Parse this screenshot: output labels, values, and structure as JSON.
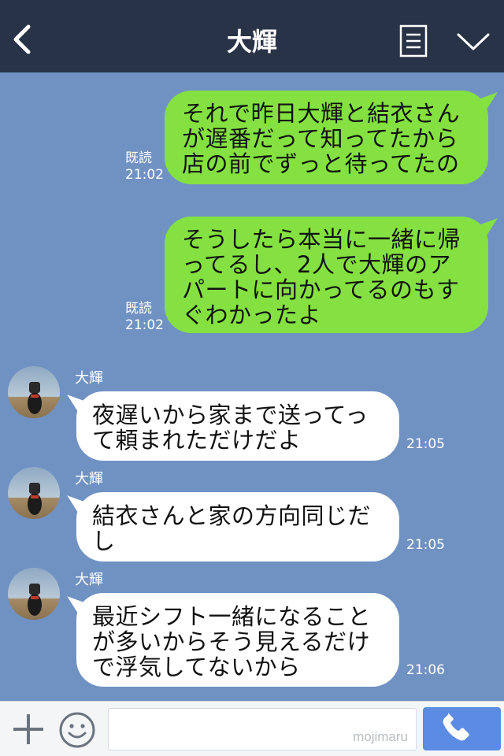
{
  "header": {
    "title": "大輝",
    "back_icon": "chevron-left-icon",
    "menu_icon": "notes-icon",
    "dropdown_icon": "chevron-down-icon",
    "background": "#293347"
  },
  "messages_out": [
    {
      "text": "それで昨日大輝と結衣さん\nが遅番だって知ってたから\n店の前でずっと待ってたの",
      "read": "既読",
      "time": "21:02"
    },
    {
      "text": "そうしたら本当に一緒に帰\nってるし、2人で大輝のア\nパートに向かってるのもす\nぐわかったよ",
      "read": "既読",
      "time": "21:02"
    }
  ],
  "messages_in": [
    {
      "sender": "大輝",
      "text": "夜遅いから家まで送ってっ\nて頼まれただけだよ",
      "time": "21:05"
    },
    {
      "sender": "大輝",
      "text": "結衣さんと家の方向同じだ\nし",
      "time": "21:05"
    },
    {
      "sender": "大輝",
      "text": "最近シフト一緒になること\nが多いからそう見えるだけ\nで浮気してないから",
      "time": "21:06"
    }
  ],
  "footer": {
    "plus_icon": "plus-icon",
    "emoji_icon": "smiley-icon",
    "input_value": "",
    "watermark": "mojimaru",
    "call_icon": "phone-icon",
    "call_color": "#5b8be3"
  },
  "colors": {
    "chat_background": "#7092c3",
    "outgoing_bubble": "#84e141",
    "incoming_bubble": "#ffffff"
  }
}
